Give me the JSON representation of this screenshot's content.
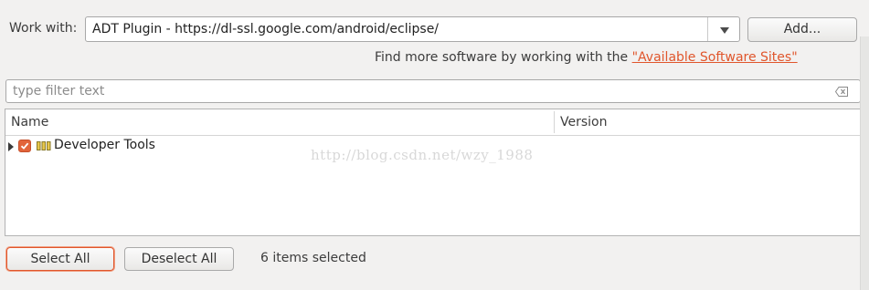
{
  "work_with": {
    "label": "Work with:",
    "value": "ADT Plugin - https://dl-ssl.google.com/android/eclipse/",
    "add_label": "Add..."
  },
  "find_more": {
    "text": "Find more software by working with the ",
    "link": "\"Available Software Sites\""
  },
  "filter": {
    "placeholder": "type filter text"
  },
  "table": {
    "columns": [
      "Name",
      "Version"
    ],
    "rows": [
      {
        "name": "Developer Tools",
        "version": "",
        "checked": true,
        "expanded": false
      }
    ]
  },
  "watermark": "http://blog.csdn.net/wzy_1988",
  "buttons": {
    "select_all": "Select All",
    "deselect_all": "Deselect All"
  },
  "status": {
    "selected_count": "6 items selected"
  },
  "colors": {
    "accent": "#e0562c",
    "link": "#e0562c",
    "background": "#f2f1f0"
  }
}
